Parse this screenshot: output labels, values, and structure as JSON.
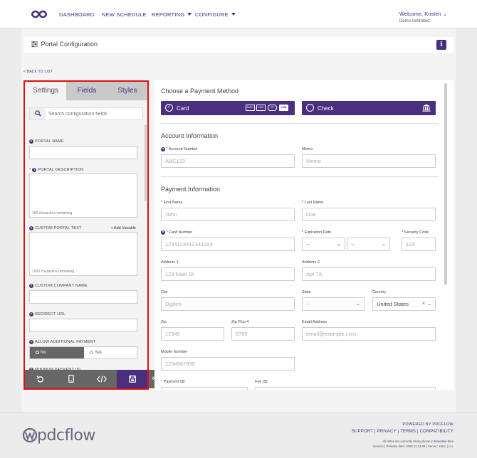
{
  "nav": {
    "items": [
      {
        "label": "DASHBOARD"
      },
      {
        "label": "NEW SCHEDULE"
      },
      {
        "label": "REPORTING"
      },
      {
        "label": "CONFIGURE"
      }
    ],
    "welcome": "Welcome, Kristen",
    "account": "Demo Unlimited"
  },
  "page": {
    "title": "Portal Configuration",
    "info_icon": "i",
    "back": "< BACK TO LIST"
  },
  "left": {
    "tabs": [
      {
        "label": "Settings"
      },
      {
        "label": "Fields"
      },
      {
        "label": "Styles"
      }
    ],
    "search_placeholder": "Search configuration fields",
    "portal_name": "PORTAL NAME",
    "portal_description": "PORTAL DESCRIPTION",
    "desc_remaining": "150 characters remaining",
    "custom_portal_text": "CUSTOM PORTAL TEXT",
    "add_variable": "+ Add Variable",
    "text_remaining": "1000 characters remaining",
    "custom_company_name": "CUSTOM COMPANY NAME",
    "redirect_url": "REDIRECT URL",
    "allow_additional_payment": "ALLOW ADDITIONAL PAYMENT",
    "no": "No",
    "yes": "Yes",
    "minimum_payment": "MINIMUM PAYMENT ($)",
    "asterisk": "*"
  },
  "right": {
    "choose_method": "Choose a Payment Method",
    "card": "Card",
    "check": "Check",
    "card_logos": [
      "AMEX",
      "DISC",
      "MC",
      "VISA"
    ],
    "account_info": "Account Information",
    "account_number_label": "Account Number",
    "account_number_ph": "ABC123",
    "memo_label": "Memo",
    "memo_ph": "Memo",
    "payment_info": "Payment Information",
    "first_name_label": "First Name",
    "first_name_ph": "John",
    "last_name_label": "Last Name",
    "last_name_ph": "Doe",
    "card_number_label": "Card Number",
    "card_number_ph": "1234123412341324",
    "expiration_label": "Expiration Date",
    "exp_month": "--",
    "exp_year": "--",
    "security_label": "Security Code",
    "security_ph": "123",
    "address1_label": "Address 1",
    "address1_ph": "123 Main St",
    "address2_label": "Address 2",
    "address2_ph": "Apt 7A",
    "city_label": "City",
    "city_ph": "Ogden",
    "state_label": "State",
    "state_val": "--",
    "country_label": "Country",
    "country_val": "United States",
    "zip_label": "Zip",
    "zip_ph": "12345",
    "zip4_label": "Zip Plus 4",
    "zip4_ph": "6789",
    "email_label": "Email Address",
    "email_ph": "email@example.com",
    "mobile_label": "Mobile Number",
    "mobile_ph": "1234567890",
    "payment_label": "Payment ($)",
    "fee_label": "Fee ($)"
  },
  "footer": {
    "brand": "pdcflow",
    "powered": "POWERED BY PDCFLOW",
    "links": "SUPPORT | PRIVACY | TERMS | COMPATIBILITY",
    "tz_prefix": "All dates are currently being shown in",
    "tz": "Mountain time",
    "version": "Version: | Release date: 2025.11.13.09 | Server: 196.L | Lin."
  },
  "colors": {
    "accent": "#4a2f7f",
    "highlight": "#e01010"
  }
}
